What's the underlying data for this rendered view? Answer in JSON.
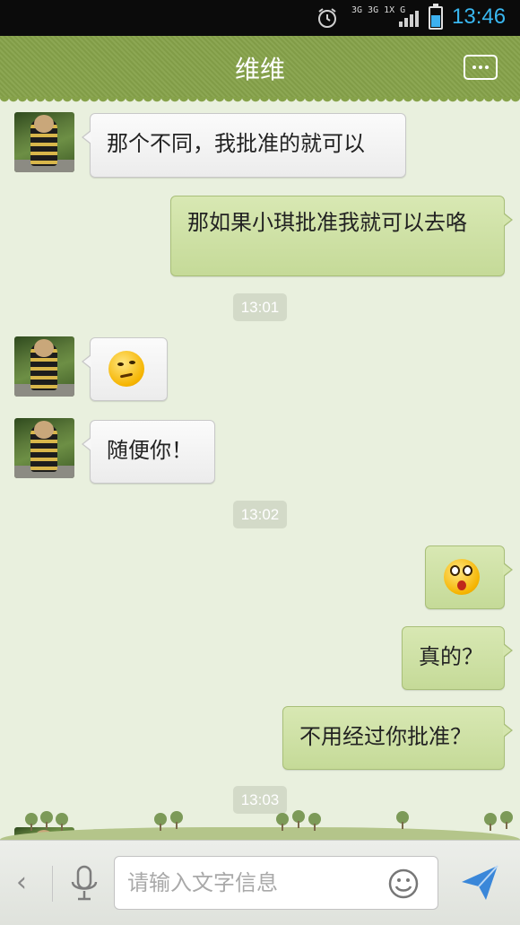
{
  "status_bar": {
    "network_label": "3G 3G 1X G",
    "time": "13:46",
    "alarm_icon": "alarm-clock-icon",
    "battery_icon": "battery-icon",
    "battery_color": "#3db1f0"
  },
  "header": {
    "title": "维维",
    "more_icon": "chat-more-icon"
  },
  "messages": [
    {
      "type": "incoming",
      "text": "那个不同，我批准的就可以"
    },
    {
      "type": "outgoing",
      "text": "那如果小琪批准我就可以去咯"
    },
    {
      "type": "timestamp",
      "text": "13:01"
    },
    {
      "type": "incoming",
      "emoji": "smirk-emoji-icon"
    },
    {
      "type": "incoming",
      "text": "随便你！"
    },
    {
      "type": "timestamp",
      "text": "13:02"
    },
    {
      "type": "outgoing",
      "emoji": "shocked-emoji-icon"
    },
    {
      "type": "outgoing",
      "text": "真的？"
    },
    {
      "type": "outgoing",
      "text": "不用经过你批准？"
    },
    {
      "type": "timestamp",
      "text": "13:03"
    }
  ],
  "input_bar": {
    "placeholder": "请输入文字信息",
    "value": "",
    "collapse_icon": "chevron-left-icon",
    "voice_icon": "microphone-icon",
    "emoji_icon": "smiley-icon",
    "send_icon": "send-icon"
  },
  "colors": {
    "title_bar": "#86a24a",
    "chat_background": "#e9f0de",
    "outgoing_bubble": "#c5da98",
    "incoming_bubble": "#ececec",
    "send_accent": "#3a87d9"
  }
}
